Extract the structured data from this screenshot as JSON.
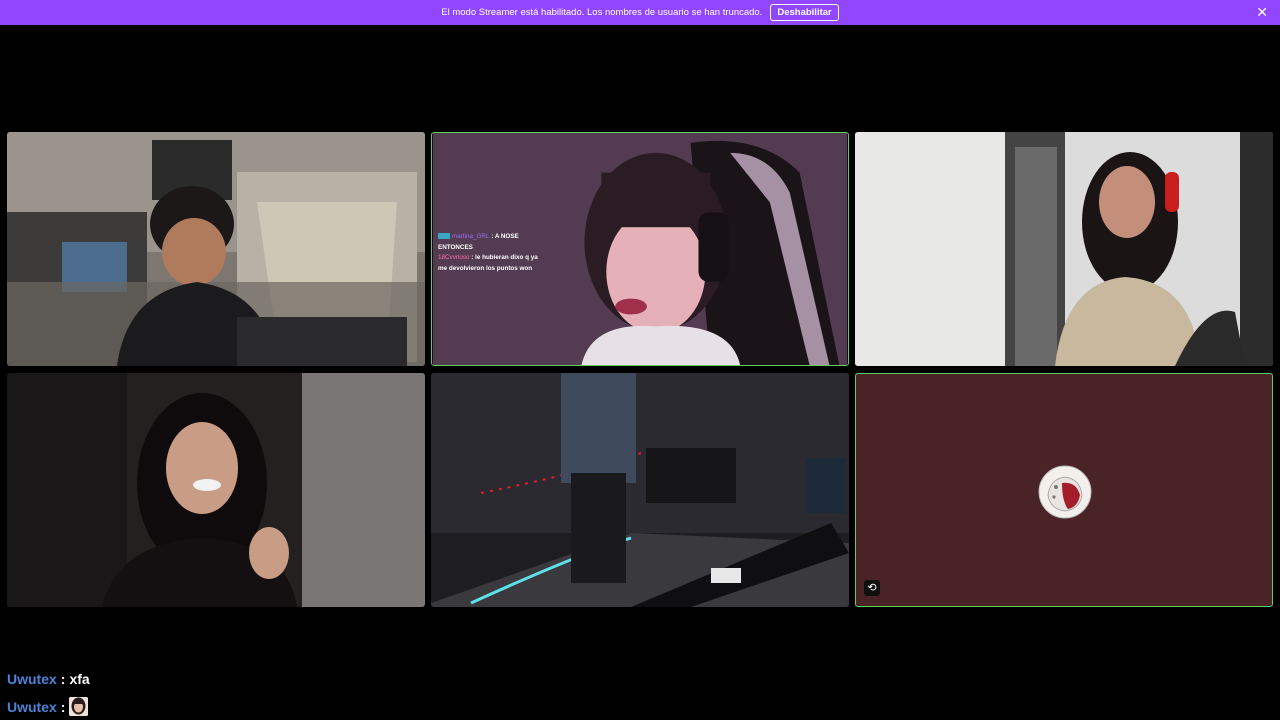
{
  "banner": {
    "message": "El modo Streamer está habilitado. Los nombres de usuario se han truncado.",
    "button_label": "Deshabilitar",
    "close_glyph": "✕",
    "color": "#9147ff"
  },
  "tiles": [
    {
      "id": "stream-1",
      "active": false
    },
    {
      "id": "stream-2",
      "active": true
    },
    {
      "id": "stream-3",
      "active": false
    },
    {
      "id": "stream-4",
      "active": false
    },
    {
      "id": "stream-5",
      "active": false
    },
    {
      "id": "stream-6",
      "active": true
    }
  ],
  "overlay_chat": {
    "line1_user": "martina_GRL",
    "line1_text": ": A NOSE",
    "line1_cont": "ENTONCES",
    "line2_user": "18Cvvrloso",
    "line2_text": ": le hubieran dixo q ya",
    "line2_cont": "me devolvieron los puntos won"
  },
  "empty_tile": {
    "background": "#4a2327",
    "corner_icon": "reset-icon",
    "corner_glyph": "⟲"
  },
  "chat": [
    {
      "user": "Uwutex",
      "sep": ":",
      "text": "xfa"
    },
    {
      "user": "Uwutex",
      "sep": ":",
      "emote": "face-emote"
    }
  ],
  "accent_colors": {
    "active_border": "#5ccf5c",
    "chat_user": "#4d83d9"
  }
}
